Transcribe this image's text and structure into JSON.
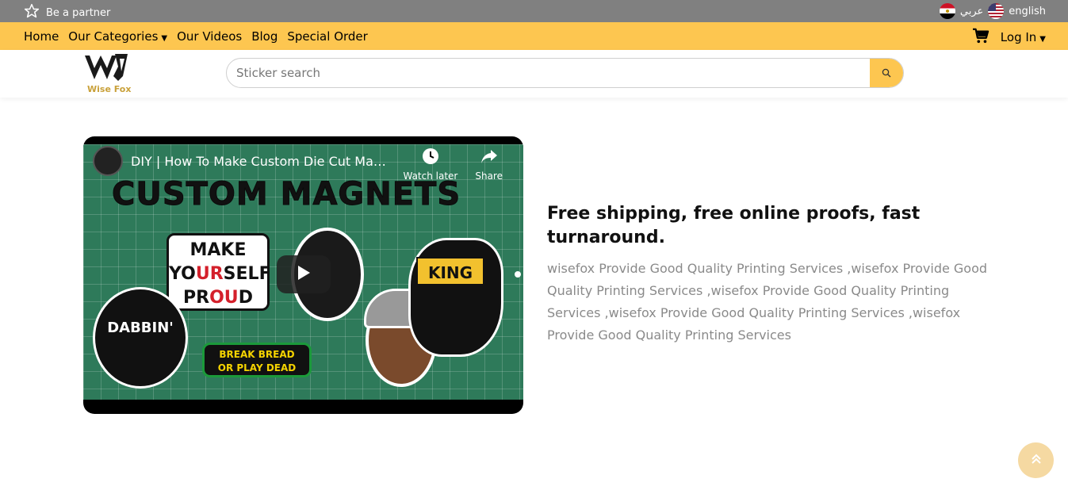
{
  "topbar": {
    "partner_label": "Be a partner",
    "arabic_label": "عربي",
    "english_label": "english"
  },
  "nav": {
    "items": [
      {
        "label": "Home"
      },
      {
        "label": "Our Categories"
      },
      {
        "label": "Our Videos"
      },
      {
        "label": "Blog"
      },
      {
        "label": "Special Order"
      }
    ],
    "login_label": "Log In"
  },
  "header": {
    "logo_text": "Wise Fox",
    "search_placeholder": "Sticker search"
  },
  "video": {
    "title": "DIY | How To Make Custom Die Cut Magnets",
    "watch_later_label": "Watch later",
    "share_label": "Share",
    "headline": "CUSTOM MAGNETS",
    "stickers": {
      "make": "MAKE",
      "yourself_1": "YO",
      "yourself_2": "UR",
      "yourself_3": "SELF",
      "proud_1": "PR",
      "proud_2": "OU",
      "proud_3": "D",
      "dabbin": "DABBIN'",
      "bread_line1": "BREAK BREAD",
      "bread_line2": "OR PLAY DEAD",
      "king": "KING"
    }
  },
  "content": {
    "heading": "Free shipping, free online proofs, fast turnaround.",
    "body": "wisefox Provide Good Quality Printing Services ,wisefox Provide Good Quality Printing Services ,wisefox Provide Good Quality Printing Services ,wisefox Provide Good Quality Printing Services ,wisefox Provide Good Quality Printing Services"
  },
  "colors": {
    "accent": "#fdc650",
    "topbar": "#808080",
    "muted_text": "#8a8a8a"
  }
}
